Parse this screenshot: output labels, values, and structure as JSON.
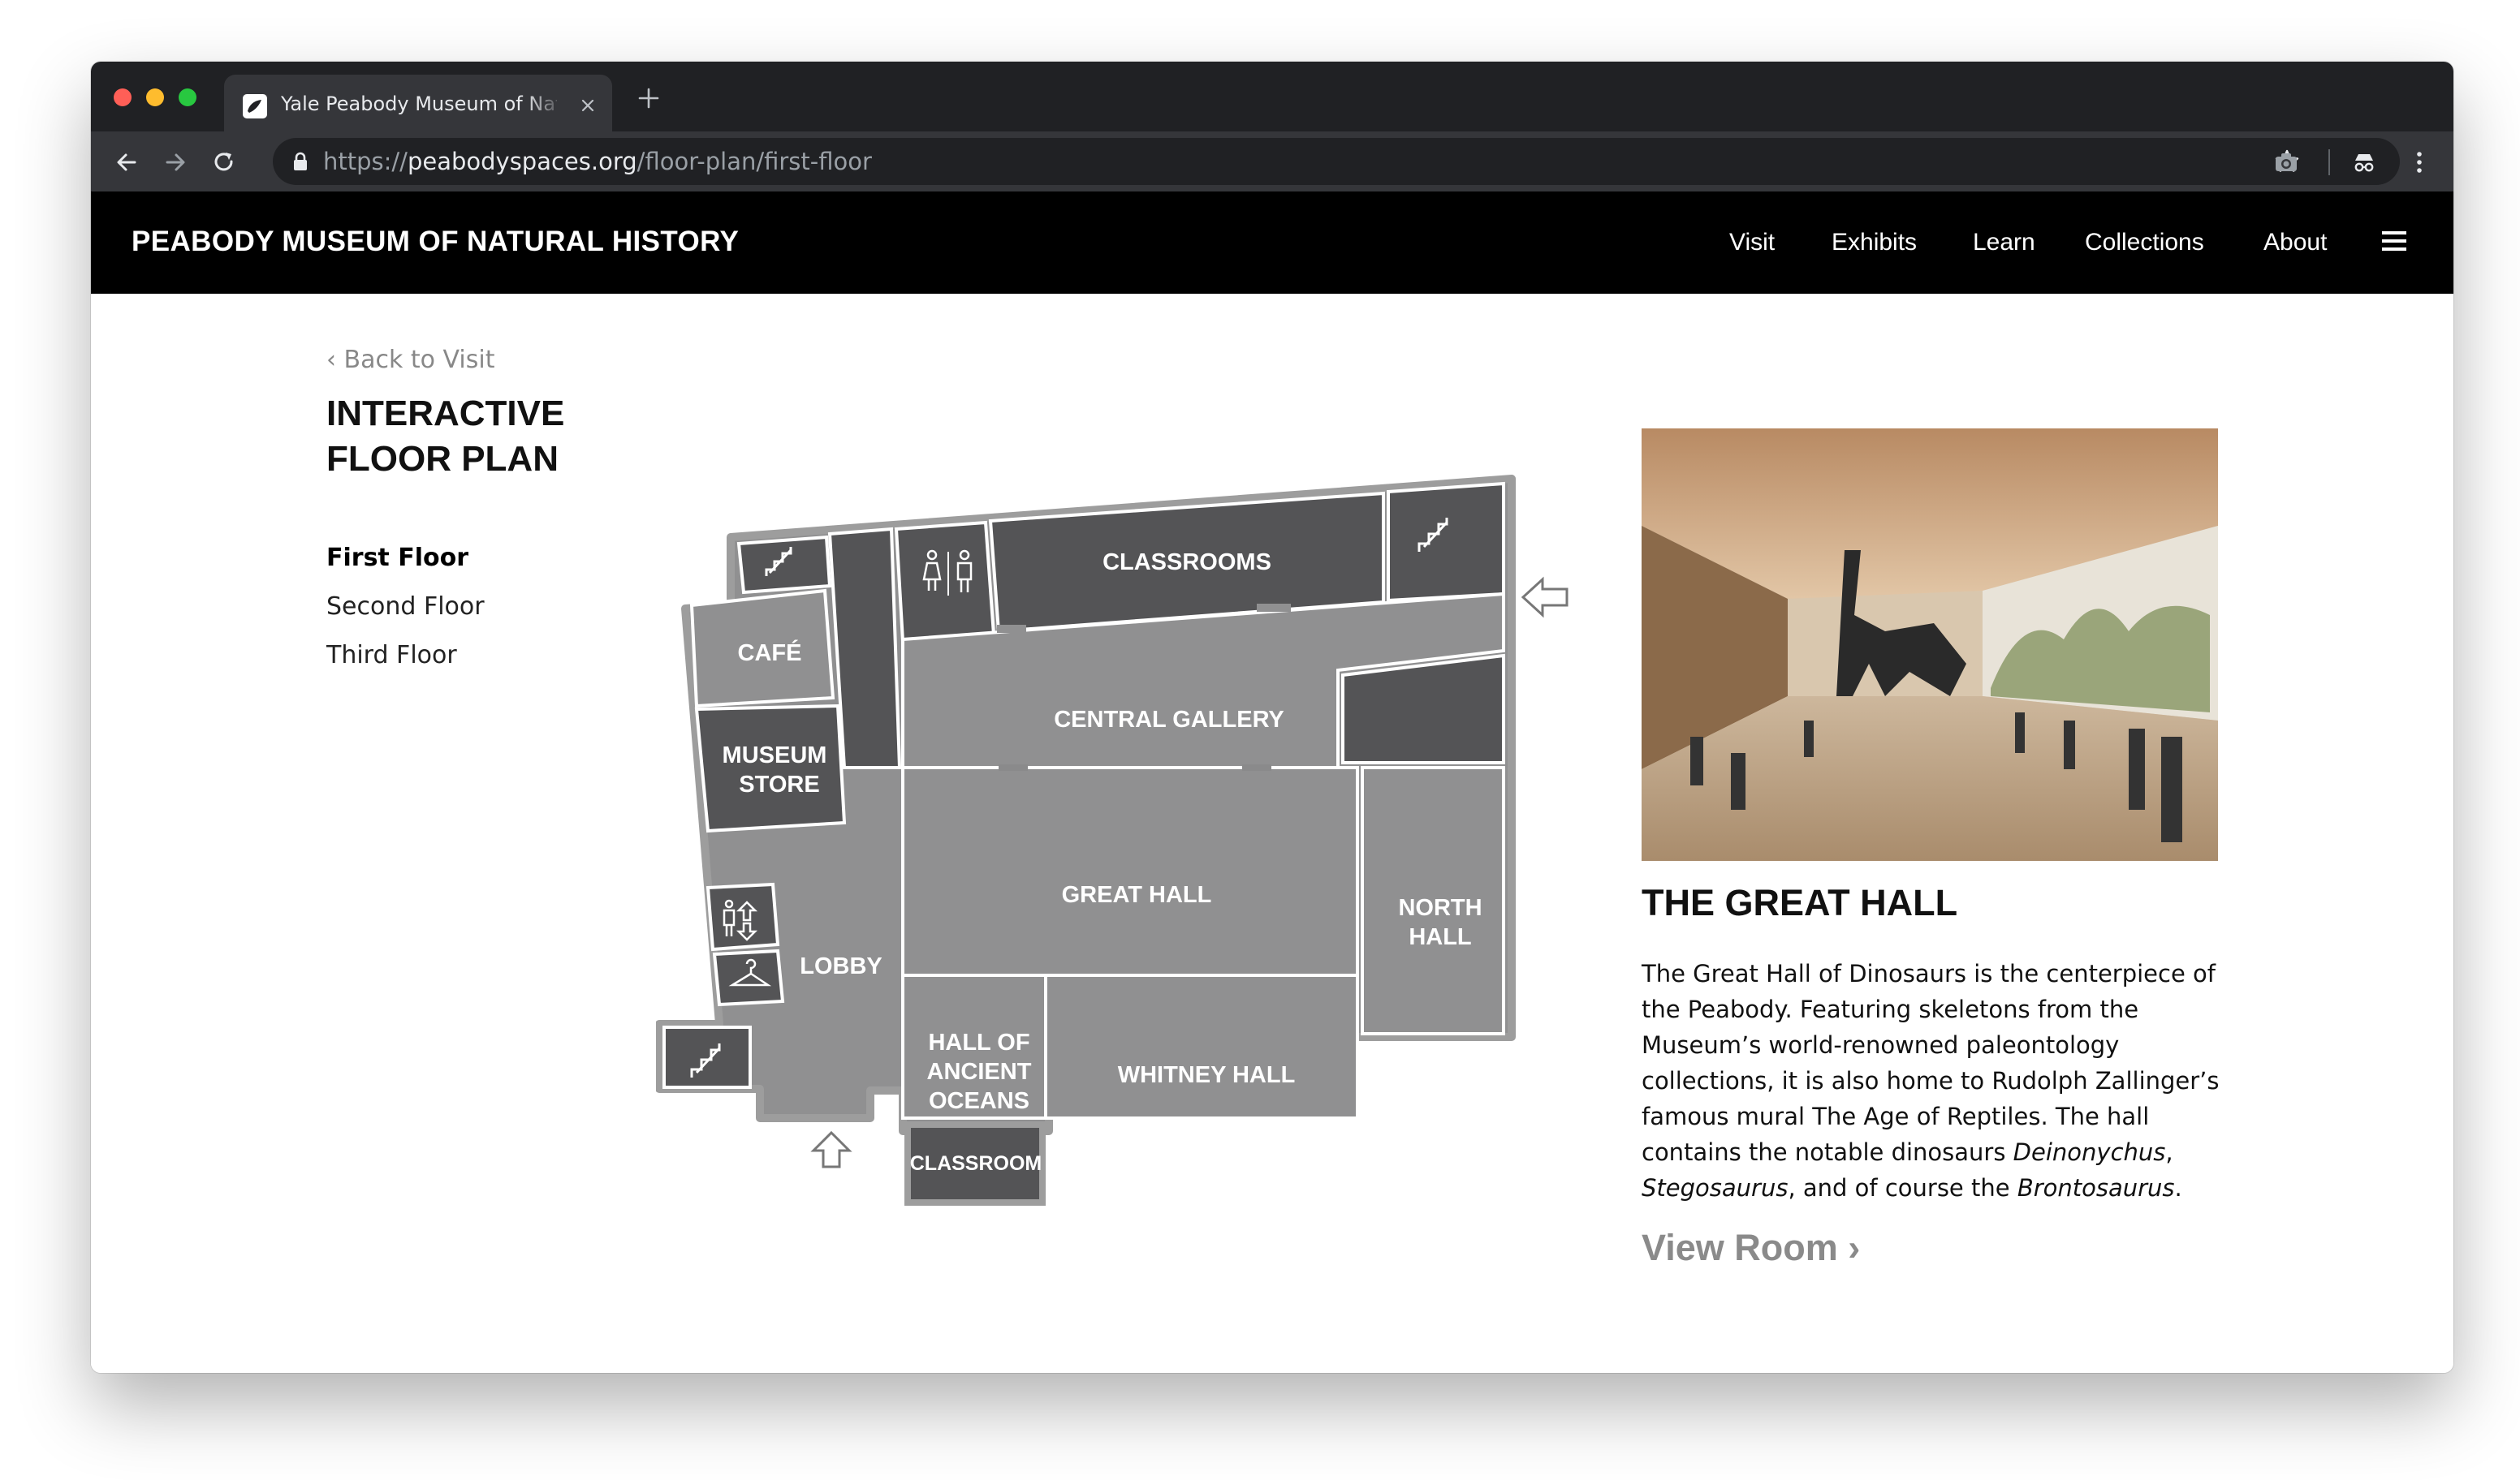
{
  "browser": {
    "tab_title": "Yale Peabody Museum of Natural History",
    "url_scheme": "https://",
    "url_host": "peabodyspaces.org",
    "url_path": "/floor-plan/first-floor"
  },
  "header": {
    "logo": "PEABODY MUSEUM OF NATURAL HISTORY",
    "nav": [
      "Visit",
      "Exhibits",
      "Learn",
      "Collections",
      "About"
    ]
  },
  "sidebar": {
    "back": "‹ Back to Visit",
    "title_line1": "INTERACTIVE",
    "title_line2": "FLOOR PLAN",
    "floors": [
      "First Floor",
      "Second Floor",
      "Third Floor"
    ],
    "active_floor": "First Floor"
  },
  "map": {
    "rooms": {
      "classrooms": "CLASSROOMS",
      "cafe": "CAFÉ",
      "central_gallery": "CENTRAL GALLERY",
      "museum_store_1": "MUSEUM",
      "museum_store_2": "STORE",
      "great_hall": "GREAT HALL",
      "north_hall_1": "NORTH",
      "north_hall_2": "HALL",
      "lobby": "LOBBY",
      "ancient_oceans_1": "HALL OF",
      "ancient_oceans_2": "ANCIENT",
      "ancient_oceans_3": "OCEANS",
      "whitney_hall": "WHITNEY HALL",
      "classroom": "CLASSROOM"
    },
    "colors": {
      "dark": "#545456",
      "light": "#909091",
      "outline": "#ffffff"
    }
  },
  "detail": {
    "title": "THE GREAT HALL",
    "desc_main": "The Great Hall of Dinosaurs is the centerpiece of the Peabody. Featuring skeletons from the Museum’s world-renowned paleontology collections, it is also home to Rudolph Zallinger’s famous mural The Age of Reptiles. The hall contains the notable dinosaurs ",
    "desc_italic1": "Deinonychus",
    "desc_sep1": ", ",
    "desc_italic2": "Stegosaurus",
    "desc_sep2": ", and of course the ",
    "desc_italic3": "Brontosaurus",
    "desc_end": ".",
    "view_room": "View Room ›"
  }
}
